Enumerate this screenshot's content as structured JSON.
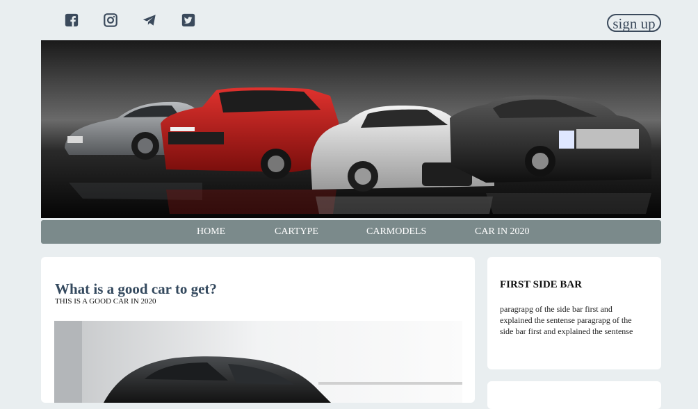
{
  "header": {
    "social_icons": [
      "facebook-icon",
      "instagram-icon",
      "telegram-icon",
      "twitter-icon"
    ],
    "signup_label": "sign up"
  },
  "nav": {
    "items": [
      {
        "label": "HOME"
      },
      {
        "label": "CARTYPE"
      },
      {
        "label": "CARMODELS"
      },
      {
        "label": "CAR IN 2020"
      }
    ]
  },
  "main_card": {
    "title": "What is a good car to get?",
    "subtitle": "THIS IS A GOOD CAR IN 2020"
  },
  "sidebar": {
    "first": {
      "title": "FIRST SIDE BAR",
      "text": "paragrapg of the side bar first and explained the sentense paragrapg of the side bar first and explained the sentense"
    }
  },
  "colors": {
    "page_bg": "#e9eef0",
    "nav_bg": "#7b8a8b",
    "title_color": "#34495e",
    "icon_color": "#3b4a5c"
  }
}
